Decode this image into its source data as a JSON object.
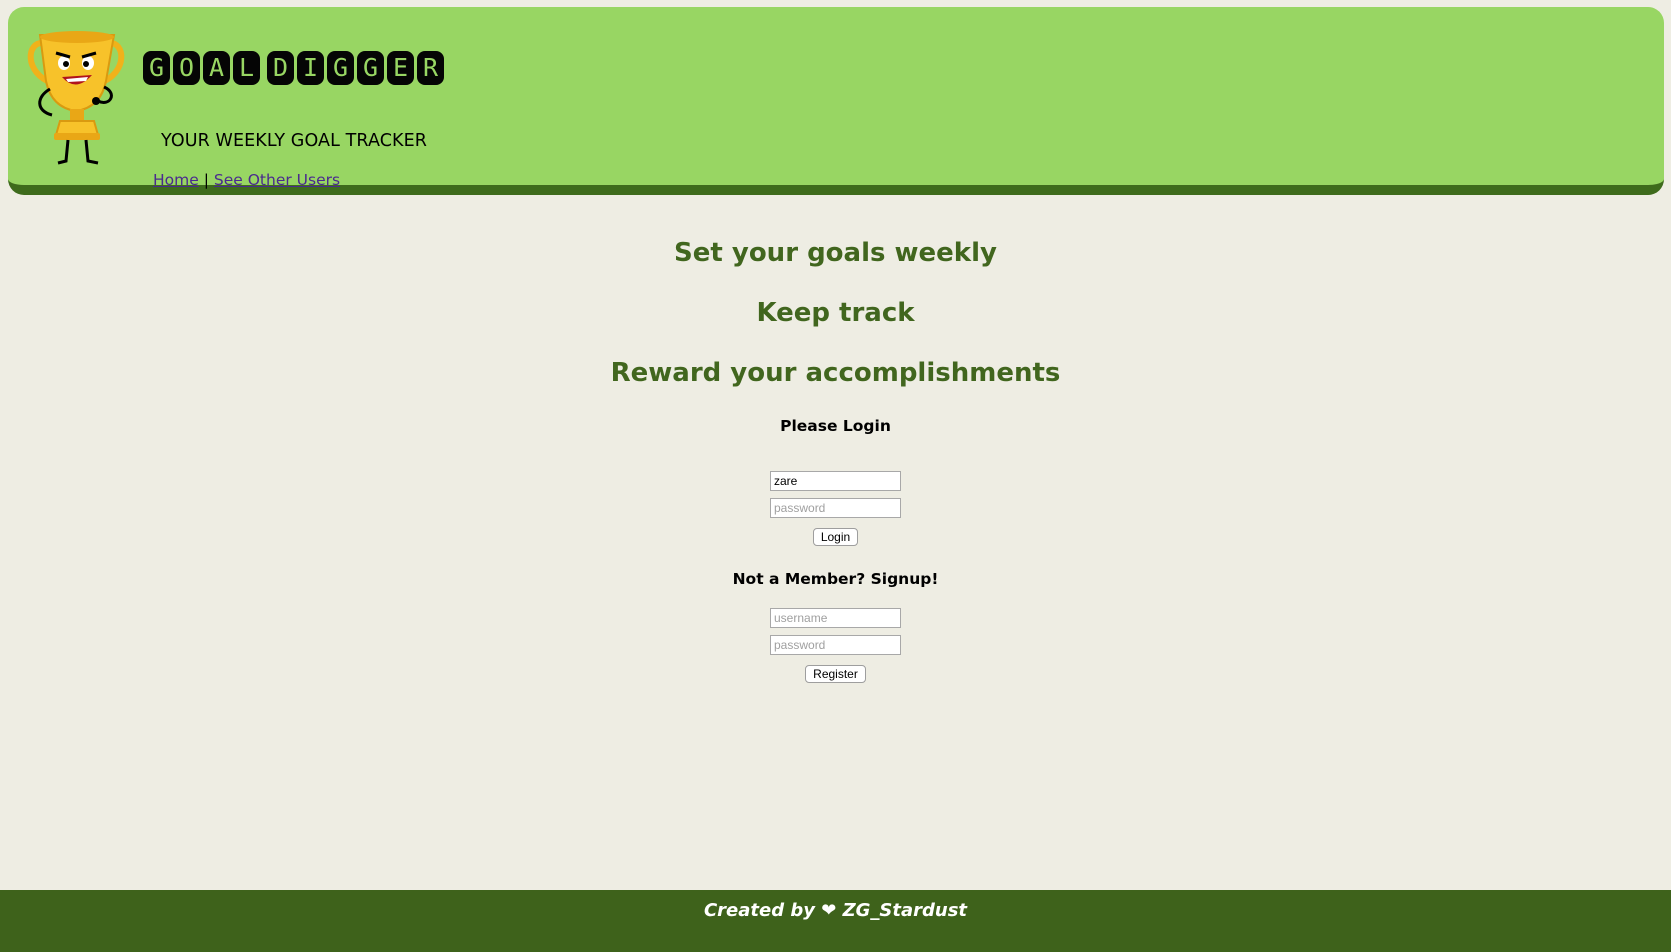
{
  "header": {
    "logo_words": [
      "GOAL",
      "DIGGER"
    ],
    "subtitle": "YOUR WEEKLY GOAL TRACKER",
    "nav": {
      "home": "Home",
      "separator": "|",
      "other_users": "See Other Users"
    }
  },
  "taglines": {
    "line1": "Set your goals weekly",
    "line2": "Keep track",
    "line3": "Reward your accomplishments"
  },
  "login": {
    "title": "Please Login",
    "username_value": "zare",
    "password_placeholder": "password",
    "button": "Login"
  },
  "signup": {
    "title": "Not a Member? Signup!",
    "username_placeholder": "username",
    "password_placeholder": "password",
    "button": "Register"
  },
  "footer": {
    "text": "Created by ❤ ZG_Stardust"
  },
  "colors": {
    "header_bg": "#98d663",
    "header_border": "#3e6b1c",
    "page_bg": "#eeede3",
    "tagline": "#41661e",
    "footer_bg": "#3e621b",
    "link": "#4a2a8e"
  },
  "icons": {
    "logo": "trophy-mascot-icon"
  }
}
